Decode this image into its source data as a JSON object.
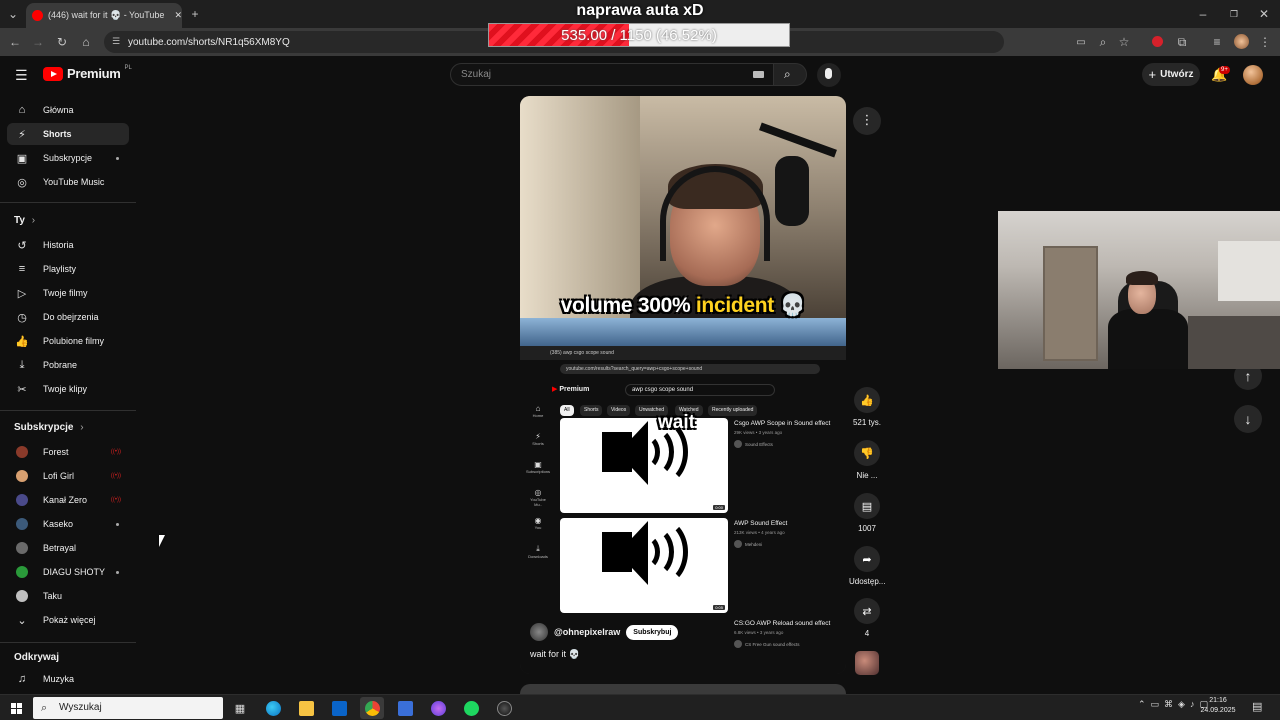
{
  "browser": {
    "tab_title": "(446) wait for it 💀 - YouTube",
    "url": "youtube.com/shorts/NR1q56XM8YQ"
  },
  "stream_overlay": {
    "title": "naprawa auta xD",
    "goal_text": "535.00 / 1150 (46.52%)",
    "goal_fraction": 0.4652
  },
  "header": {
    "logo_word": "Premium",
    "logo_region": "PL",
    "search_placeholder": "Szukaj",
    "create_label": "Utwórz",
    "notifications_badge": "9+"
  },
  "sidebar": {
    "main": [
      {
        "label": "Główna",
        "icon": "home-icon"
      },
      {
        "label": "Shorts",
        "icon": "shorts-icon",
        "active": true
      },
      {
        "label": "Subskrypcje",
        "icon": "subscriptions-icon"
      },
      {
        "label": "YouTube Music",
        "icon": "music-icon"
      }
    ],
    "you_heading": "Ty",
    "you": [
      {
        "label": "Historia",
        "icon": "history-icon"
      },
      {
        "label": "Playlisty",
        "icon": "playlists-icon"
      },
      {
        "label": "Twoje filmy",
        "icon": "your-videos-icon"
      },
      {
        "label": "Do obejrzenia",
        "icon": "watch-later-icon"
      },
      {
        "label": "Polubione filmy",
        "icon": "liked-icon"
      },
      {
        "label": "Pobrane",
        "icon": "download-icon"
      },
      {
        "label": "Twoje klipy",
        "icon": "clips-icon"
      }
    ],
    "subs_heading": "Subskrypcje",
    "subs": [
      {
        "label": "Forest",
        "color": "#8a3a2a"
      },
      {
        "label": "Lofi Girl",
        "color": "#d8a070"
      },
      {
        "label": "Kanał Zero",
        "color": "#4a4a8a"
      },
      {
        "label": "Kaseko",
        "color": "#3c5a7a"
      },
      {
        "label": "Betrayal",
        "color": "#6a6a6a"
      },
      {
        "label": "DIAGU SHOTY",
        "color": "#2a9a3a"
      },
      {
        "label": "Taku",
        "color": "#c0c0c0"
      }
    ],
    "show_more": "Pokaż więcej",
    "explore_heading": "Odkrywaj",
    "explore": [
      {
        "label": "Muzyka",
        "icon": "music-note-icon"
      }
    ]
  },
  "short": {
    "caption_pre": "volume 300% ",
    "caption_hl": "incident",
    "caption_emoji": "💀",
    "channel": "@ohnepixelraw",
    "subscribe": "Subskrybuj",
    "title": "wait for it 💀",
    "overlay_word": "wait",
    "inner": {
      "tab": "(385) awp csgo scope sound",
      "url": "youtube.com/results?search_query=awp+csgo+scope+sound",
      "search": "awp csgo scope sound",
      "logo": "Premium",
      "chips": [
        "All",
        "Shorts",
        "Videos",
        "Unwatched",
        "Watched",
        "Recently uploaded"
      ],
      "side": [
        "Home",
        "Shorts",
        "Subscriptions",
        "YouTube Mu..",
        "You",
        "Downloads"
      ],
      "results": [
        {
          "title": "Csgo AWP Scope in Sound effect",
          "meta": "29K views • 3 years ago",
          "channel": "Sound Effects",
          "dur": "0:00"
        },
        {
          "title": "AWP Sound Effect",
          "meta": "213K views • 4 years ago",
          "channel": "Mehdeni",
          "dur": "0:05"
        },
        {
          "title": "CS:GO AWP Reload sound effect",
          "meta": "6.8K views • 3 years ago",
          "channel": "CS Free Gun sound effects",
          "dur": ""
        }
      ]
    }
  },
  "actions": {
    "likes": "521 tys.",
    "dislike": "Nie ...",
    "comments": "1007",
    "share": "Udostęp...",
    "remix": "4"
  },
  "taskbar": {
    "search": "Wyszukaj",
    "time": "21:16",
    "date": "24.09.2025"
  }
}
